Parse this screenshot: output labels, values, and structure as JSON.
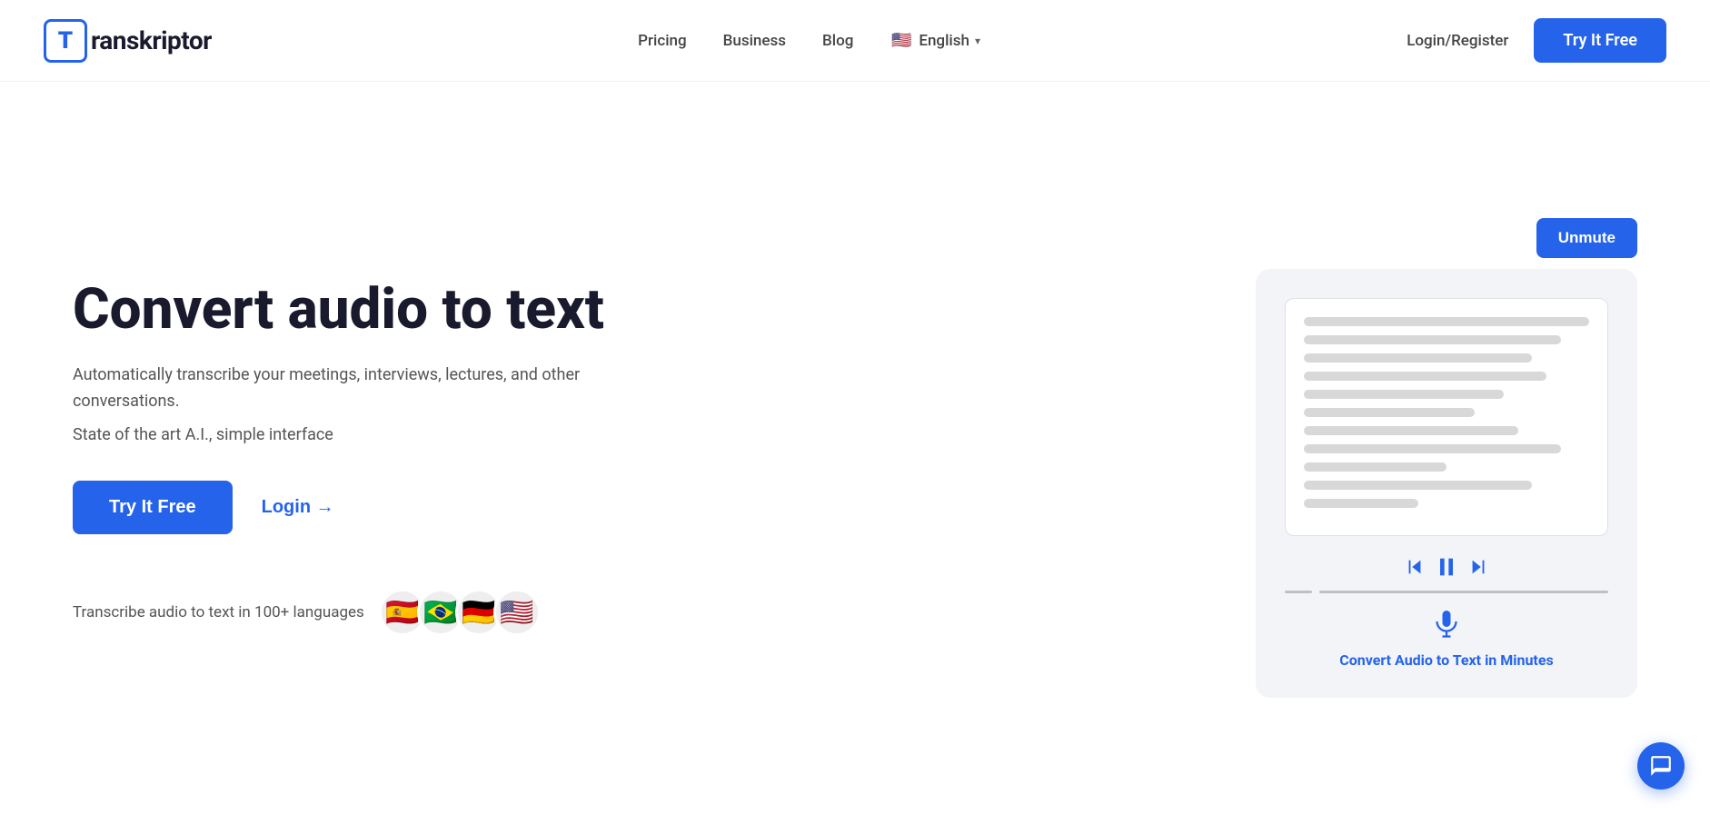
{
  "navbar": {
    "logo_letter": "T",
    "logo_text": "ranskriptor",
    "links": [
      {
        "label": "Pricing",
        "id": "pricing"
      },
      {
        "label": "Business",
        "id": "business"
      },
      {
        "label": "Blog",
        "id": "blog"
      }
    ],
    "language": "English",
    "login_register": "Login/Register",
    "try_free_label": "Try It Free"
  },
  "hero": {
    "title": "Convert audio to text",
    "subtitle1": "Automatically transcribe your meetings, interviews, lectures, and other conversations.",
    "subtitle2": "State of the art A.I., simple interface",
    "try_free_label": "Try It Free",
    "login_label": "Login →",
    "languages_text": "Transcribe audio to text in 100+ languages",
    "flags": [
      "🇪🇸",
      "🇧🇷",
      "🇩🇪",
      "🇺🇸"
    ]
  },
  "demo": {
    "unmute_label": "Unmute",
    "caption": "Convert Audio to Text in Minutes"
  },
  "icons": {
    "flag_us": "🇺🇸",
    "chevron": "▾",
    "arrow_right": "→",
    "chat": "chat"
  }
}
